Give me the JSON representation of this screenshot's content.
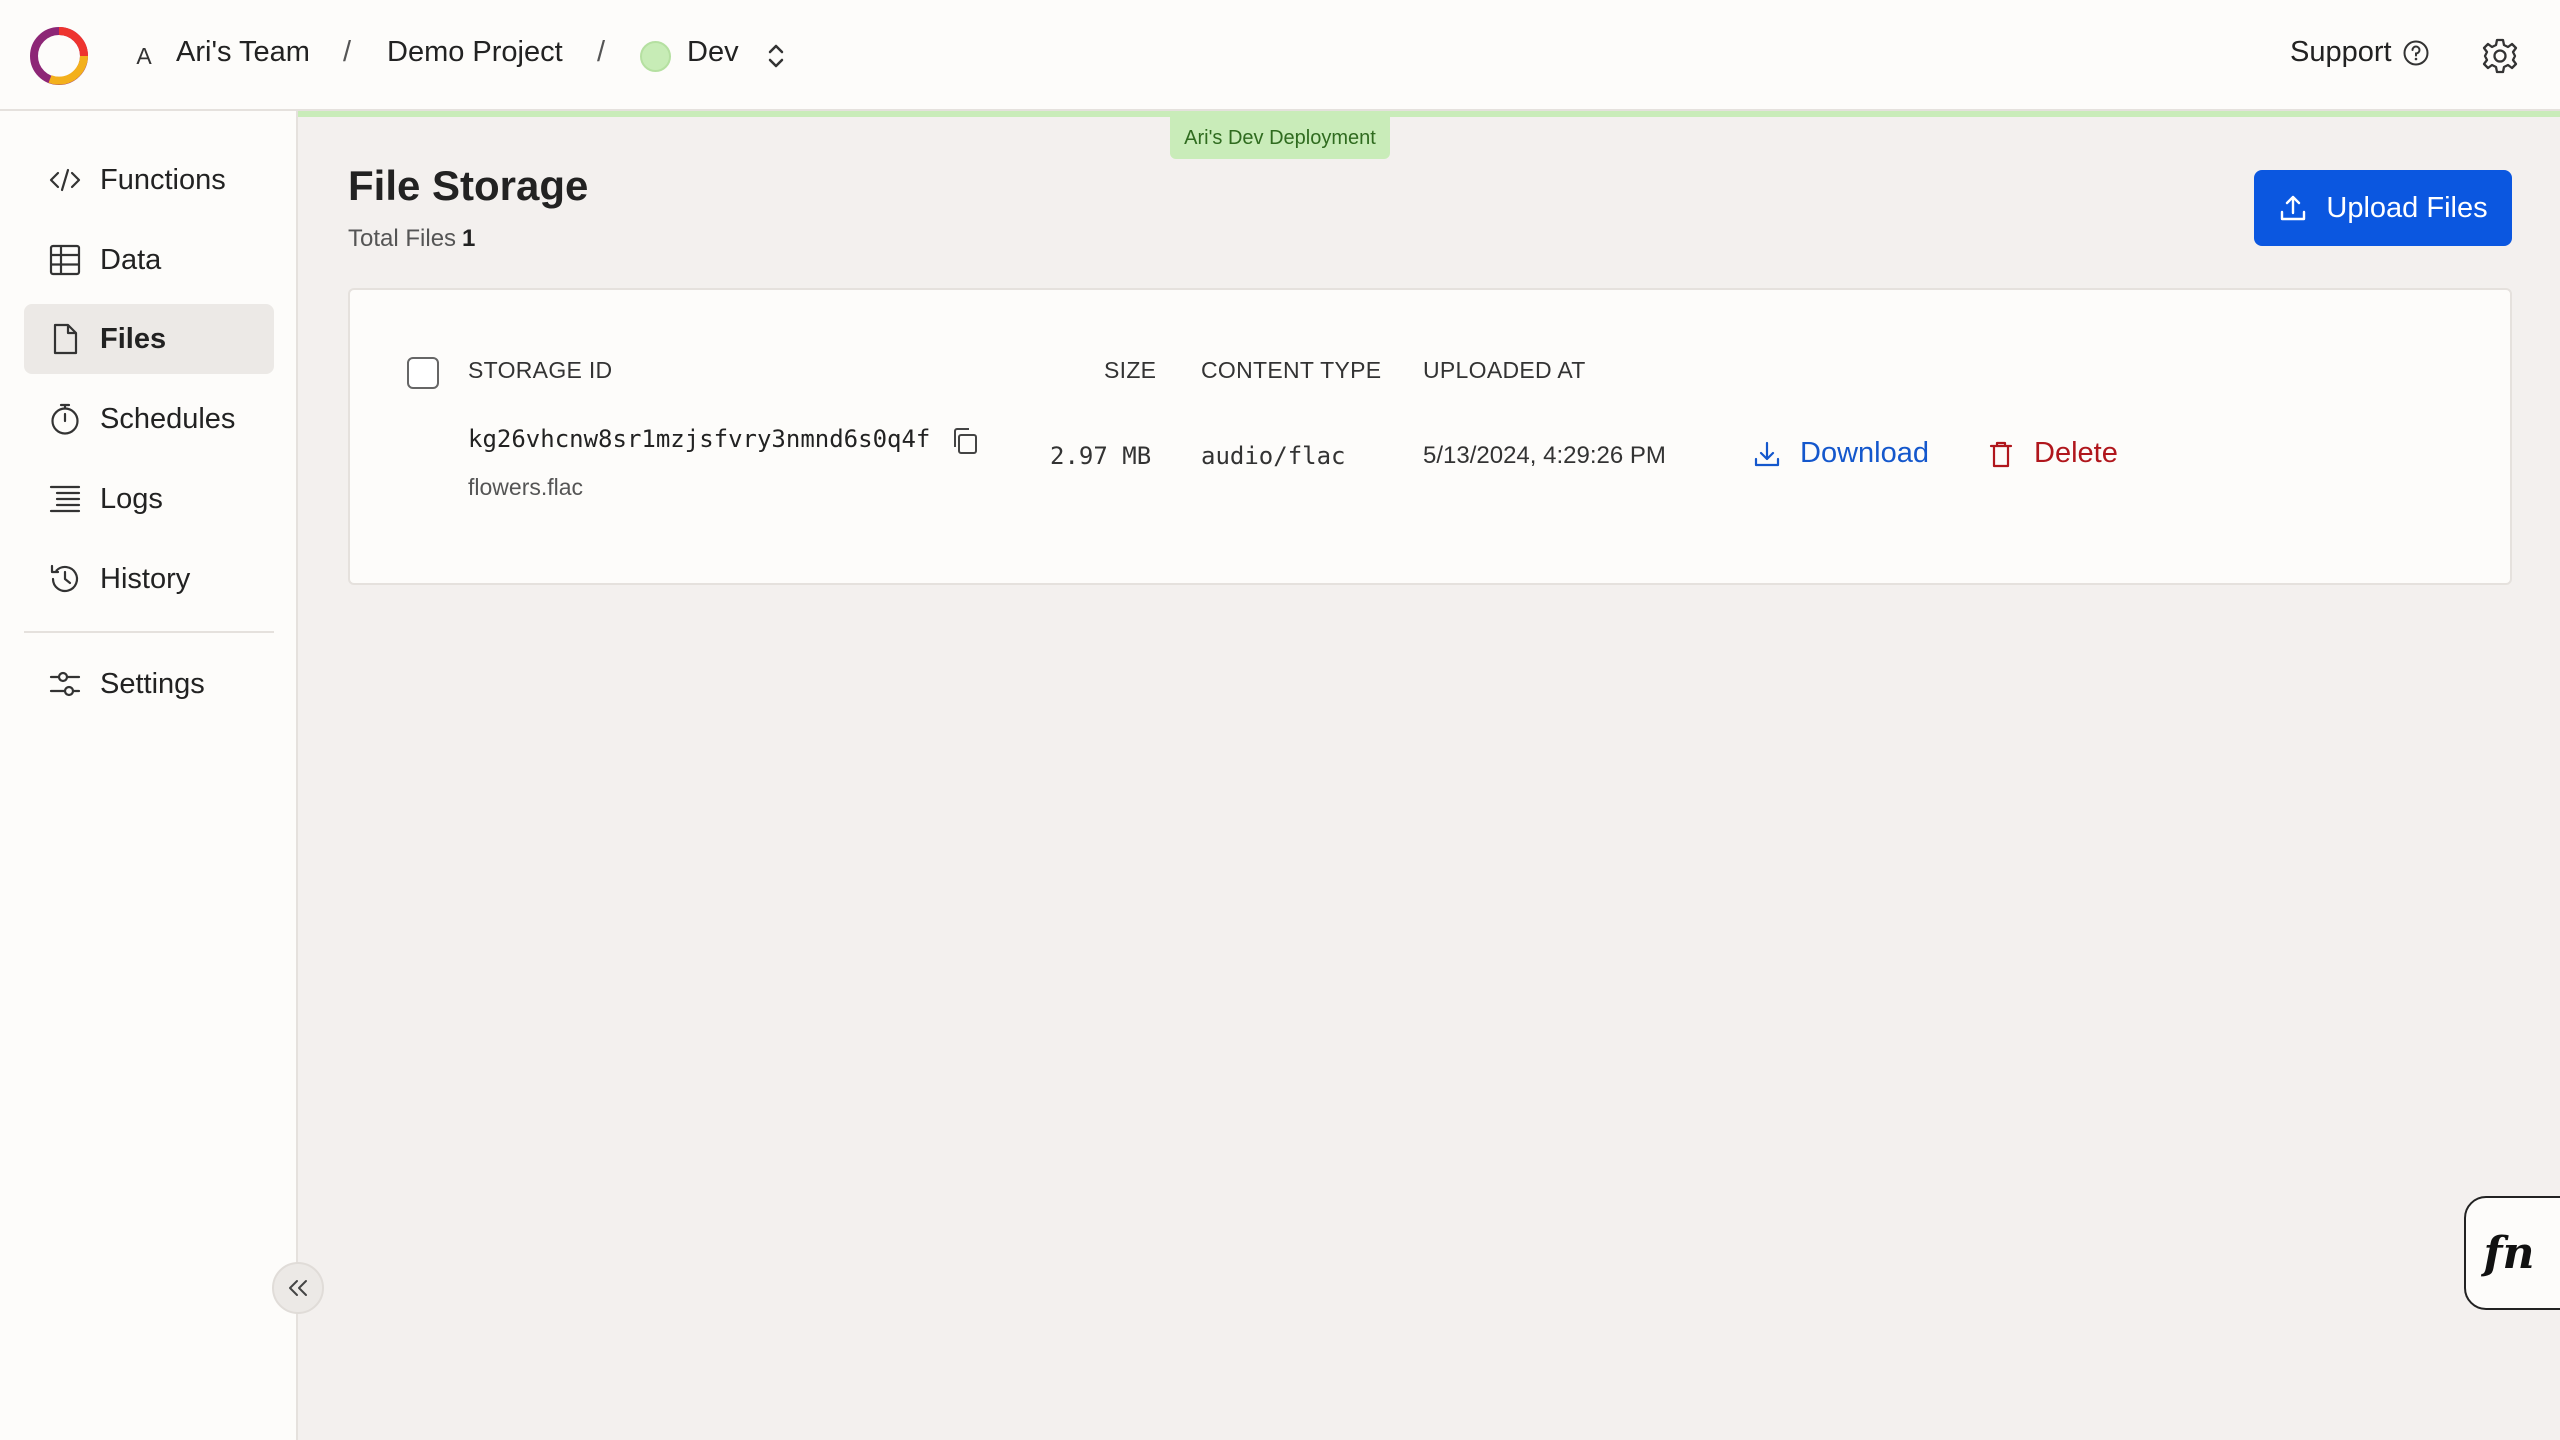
{
  "header": {
    "team_initial": "A",
    "team_name": "Ari's Team",
    "separator": "/",
    "project_name": "Demo Project",
    "environment": "Dev",
    "support_label": "Support"
  },
  "deployment": {
    "badge": "Ari's Dev Deployment",
    "color": "#c9ecb9"
  },
  "sidebar": {
    "items": [
      {
        "label": "Functions",
        "icon": "code-icon"
      },
      {
        "label": "Data",
        "icon": "table-icon"
      },
      {
        "label": "Files",
        "icon": "file-icon",
        "active": true
      },
      {
        "label": "Schedules",
        "icon": "stopwatch-icon"
      },
      {
        "label": "Logs",
        "icon": "list-icon"
      },
      {
        "label": "History",
        "icon": "history-icon"
      }
    ],
    "settings_label": "Settings"
  },
  "main": {
    "title": "File Storage",
    "total_label": "Total Files",
    "total_count": "1",
    "upload_label": "Upload Files"
  },
  "table": {
    "headers": {
      "storage_id": "STORAGE ID",
      "size": "SIZE",
      "content_type": "CONTENT TYPE",
      "uploaded_at": "UPLOADED AT"
    },
    "rows": [
      {
        "storage_id": "kg26vhcnw8sr1mzjsfvry3nmnd6s0q4f",
        "file_name": "flowers.flac",
        "size": "2.97 MB",
        "content_type": "audio/flac",
        "uploaded_at": "5/13/2024, 4:29:26 PM",
        "download_label": "Download",
        "delete_label": "Delete"
      }
    ]
  },
  "fn_button": "fn",
  "colors": {
    "accent": "#0b57e0",
    "link": "#1457cc",
    "danger": "#b0161c",
    "background": "#f3f0ee"
  }
}
